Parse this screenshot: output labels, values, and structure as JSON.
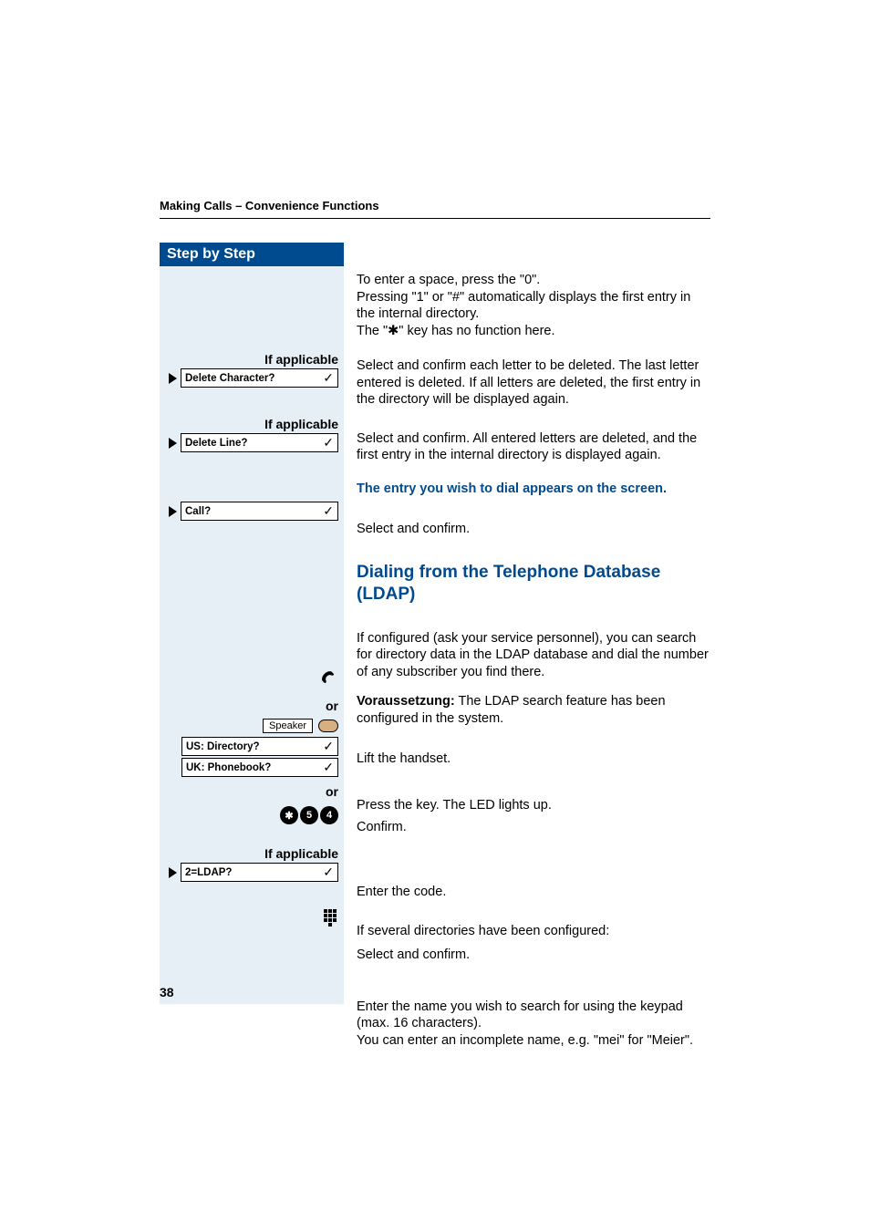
{
  "running_header": "Making Calls – Convenience Functions",
  "step_header": "Step by Step",
  "page_number": "38",
  "left": {
    "if_applicable": "If applicable",
    "or": "or",
    "delete_character": "Delete Character?",
    "delete_line": "Delete Line?",
    "call": "Call?",
    "speaker": "Speaker",
    "us_directory": "US: Directory?",
    "uk_phonebook": "UK: Phonebook?",
    "ldap": "2=LDAP?",
    "code_keys": [
      "✱",
      "5",
      "4"
    ],
    "checkmark": "✓"
  },
  "right": {
    "para1_l1": "To enter a space, press the \"0\".",
    "para1_l2": "Pressing \"1\" or \"#\" automatically displays the first entry in the internal directory.",
    "para1_l3": "The \"✱\" key has no function here.",
    "delete_char_text": "Select and confirm each letter to be deleted. The last letter entered is deleted. If all letters are deleted, the first entry in the directory will be displayed again.",
    "delete_line_text": "Select and confirm. All entered letters are deleted, and the first entry in the internal directory is displayed again.",
    "entry_appears": "The entry you wish to dial appears on the screen.",
    "select_confirm": "Select and confirm.",
    "ldap_heading": "Dialing from the Telephone Database (LDAP)",
    "ldap_intro": "If configured (ask your service personnel), you can search for directory data in the LDAP database and dial the number of any subscriber you find there.",
    "voraus_label": "Voraussetzung:",
    "voraus_text": " The LDAP search feature has been configured in the system.",
    "lift_handset": "Lift the handset.",
    "press_key": "Press the key. The LED lights up.",
    "confirm": "Confirm.",
    "enter_code": "Enter the code.",
    "several_dirs": "If several directories have been configured:",
    "enter_name": "Enter the name you wish to search for using the keypad (max. 16 characters).",
    "incomplete": "You can enter an incomplete name, e.g. \"mei\" for \"Meier\"."
  }
}
